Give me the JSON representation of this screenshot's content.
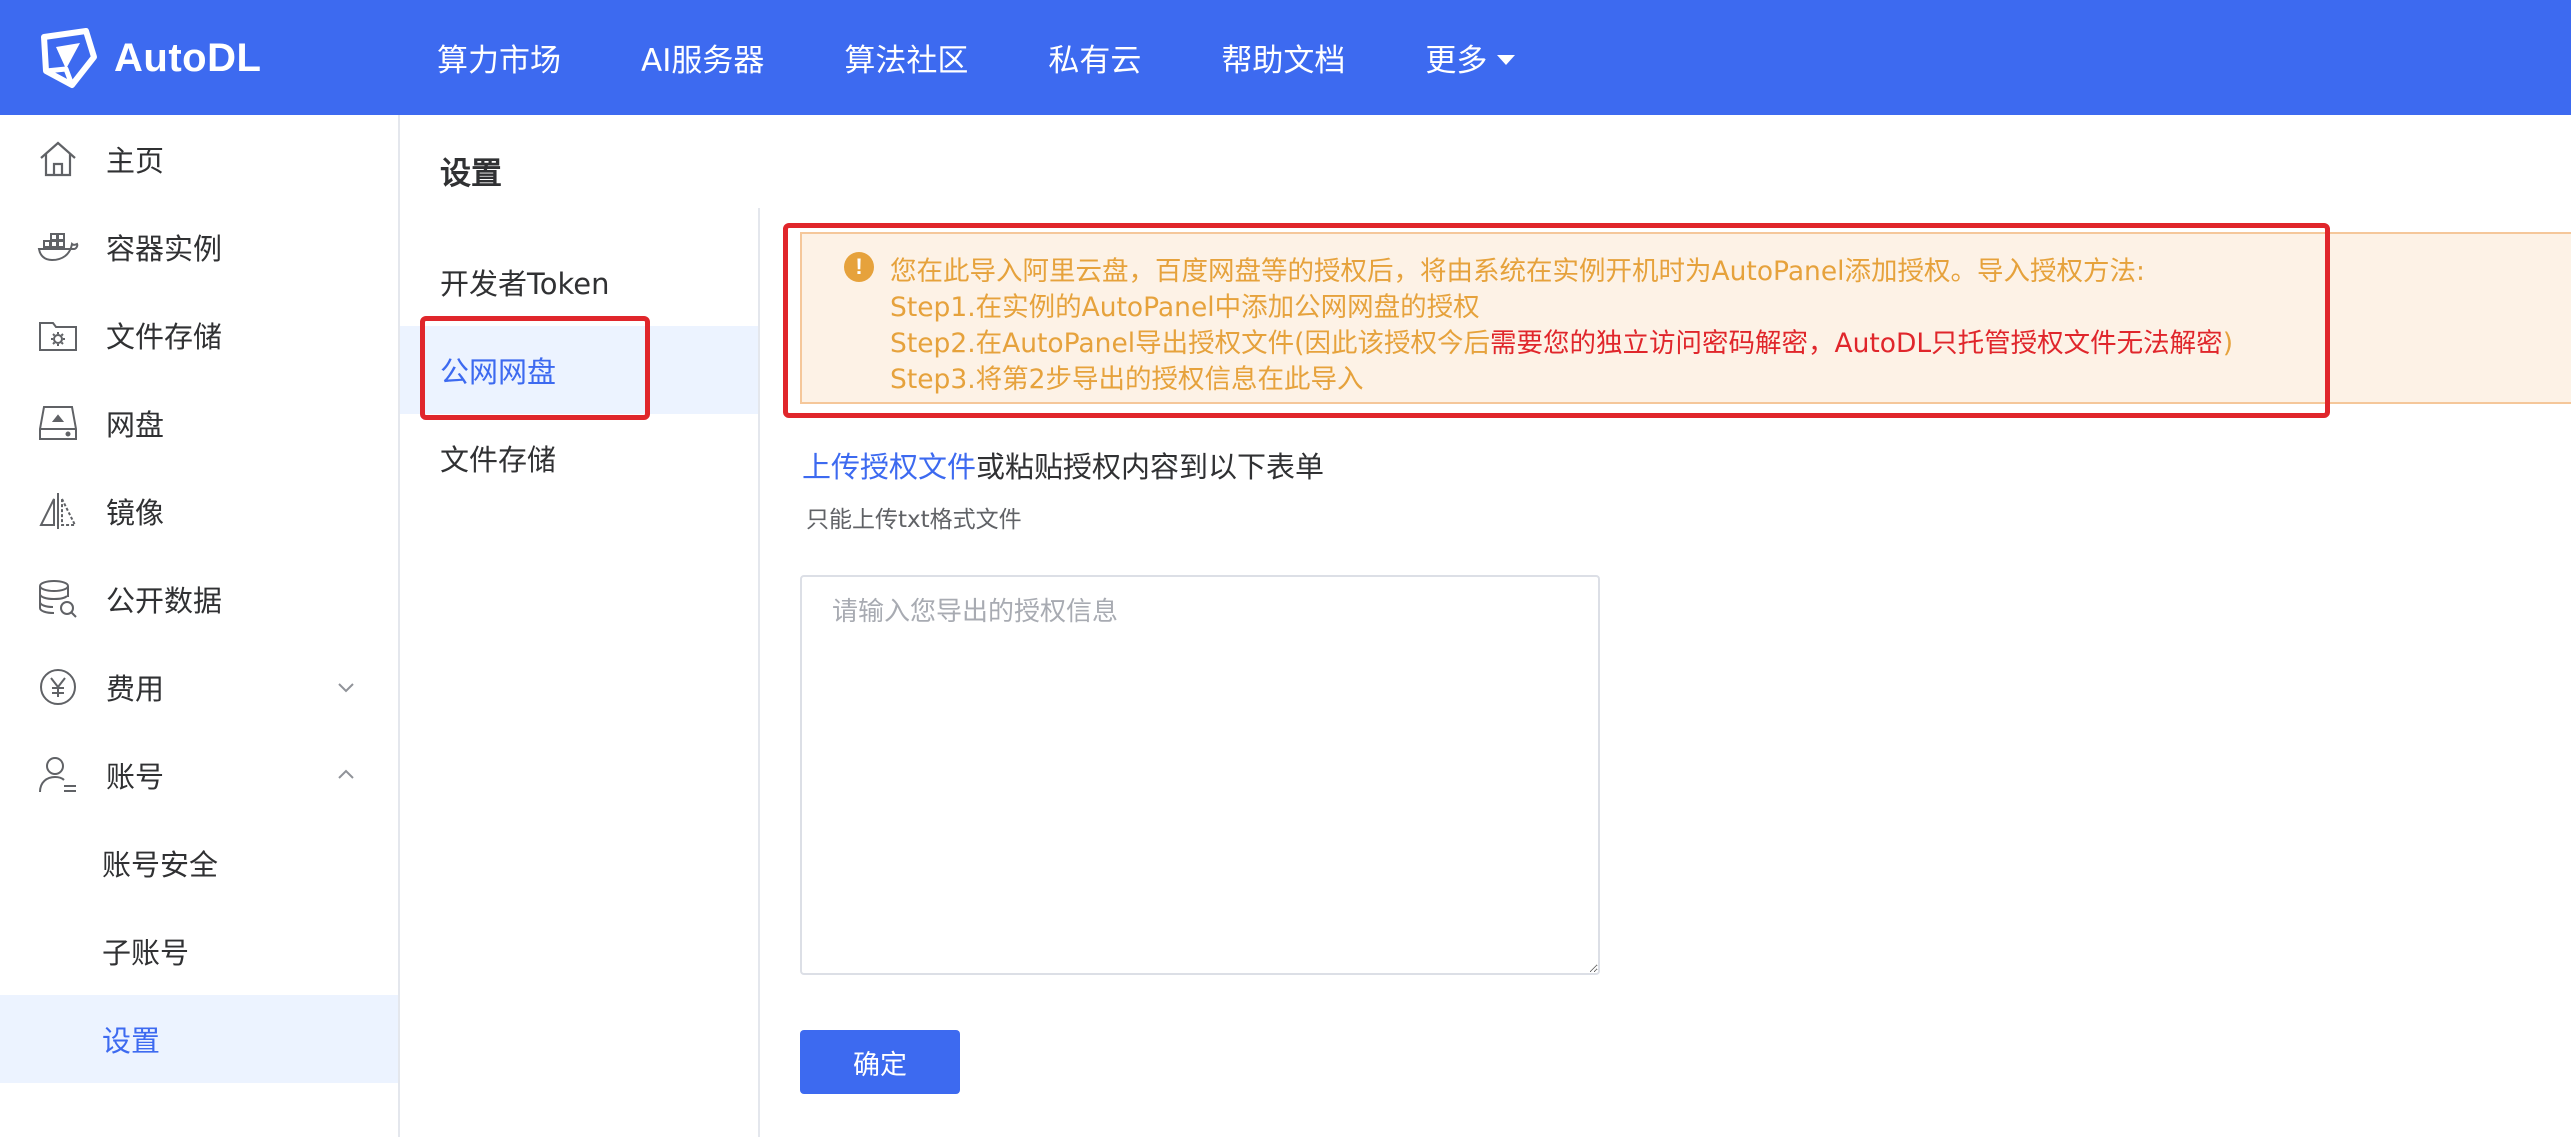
{
  "brand": {
    "name": "AutoDL",
    "logo_icon": "autodl-logo-icon"
  },
  "nav": {
    "items": [
      "算力市场",
      "AI服务器",
      "算法社区",
      "私有云",
      "帮助文档"
    ],
    "more_label": "更多"
  },
  "sidebar": {
    "items": [
      {
        "label": "主页",
        "icon": "home-icon"
      },
      {
        "label": "容器实例",
        "icon": "docker-icon"
      },
      {
        "label": "文件存储",
        "icon": "folder-gear-icon"
      },
      {
        "label": "网盘",
        "icon": "disk-icon"
      },
      {
        "label": "镜像",
        "icon": "mirror-icon"
      },
      {
        "label": "公开数据",
        "icon": "database-search-icon"
      },
      {
        "label": "费用",
        "icon": "yen-icon",
        "expanded": false
      },
      {
        "label": "账号",
        "icon": "user-icon",
        "expanded": true
      }
    ],
    "sub_items": [
      "账号安全",
      "子账号",
      "设置"
    ],
    "active": "设置"
  },
  "page": {
    "title": "设置"
  },
  "settings_menu": {
    "items": [
      "开发者Token",
      "公网网盘",
      "文件存储"
    ],
    "active": "公网网盘"
  },
  "alert": {
    "icon": "exclamation-circle-icon",
    "line1": "您在此导入阿里云盘，百度网盘等的授权后，将由系统在实例开机时为AutoPanel添加授权。导入授权方法:",
    "line2": "Step1.在实例的AutoPanel中添加公网网盘的授权",
    "line3_prefix": "Step2.在AutoPanel导出授权文件(因此该授权今后",
    "line3_red": "需要您的独立访问密码解密，AutoDL只托管授权文件无法解密",
    "line3_suffix": ")",
    "line4": "Step3.将第2步导出的授权信息在此导入",
    "color": "#e6a23c",
    "emphasis_color": "#e0262b"
  },
  "upload": {
    "link_label": "上传授权文件",
    "rest_label": "或粘贴授权内容到以下表单",
    "hint": "只能上传txt格式文件"
  },
  "form": {
    "placeholder": "请输入您导出的授权信息",
    "value": "",
    "submit_label": "确定"
  },
  "colors": {
    "primary": "#3d6af0",
    "highlight_border": "#e0262b",
    "active_bg": "#ecf3ff"
  }
}
